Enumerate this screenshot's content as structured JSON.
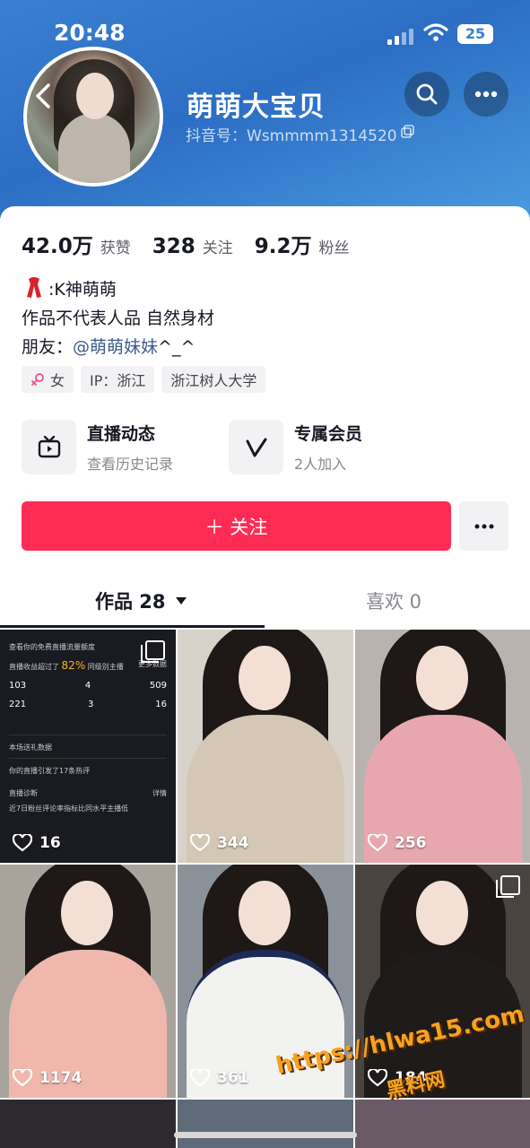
{
  "status": {
    "time": "20:48",
    "battery": "25"
  },
  "profile": {
    "name": "萌萌大宝贝",
    "douyin_id": "抖音号：Wsmmmm1314520",
    "stats": [
      {
        "value": "42.0万",
        "label": "获赞"
      },
      {
        "value": "328",
        "label": "关注"
      },
      {
        "value": "9.2万",
        "label": "粉丝"
      }
    ],
    "bio_line1": ":K神萌萌",
    "bio_line2": "作品不代表人品 自然身材",
    "bio_line3_prefix": "朋友：",
    "bio_line3_mention": "@萌萌妹妹",
    "bio_line3_suffix": "^_^",
    "tags": {
      "gender": "女",
      "ip": "IP：浙江",
      "school": "浙江树人大学"
    }
  },
  "entries": [
    {
      "title": "直播动态",
      "subtitle": "查看历史记录",
      "icon": "tv-icon"
    },
    {
      "title": "专属会员",
      "subtitle": "2人加入",
      "icon": "v-icon"
    }
  ],
  "actions": {
    "follow_label": "＋ 关注"
  },
  "tabs": {
    "works": "作品 28",
    "likes": "喜欢 0"
  },
  "dash": {
    "title": "查看你的免费直播流量额度",
    "line": "直播收益超过了",
    "pct": "82%",
    "line_tail": "同级别主播",
    "more": "更多数据",
    "nums": [
      "103",
      "4",
      "509",
      "221",
      "3",
      "16"
    ],
    "gift": "本场送礼数据",
    "hot": "你的直播引发了17条热评",
    "diag": "直播诊断",
    "detail": "详情",
    "note": "近7日粉丝评论率指标比同水平主播低"
  },
  "videos": [
    {
      "likes": "16"
    },
    {
      "likes": "344"
    },
    {
      "likes": "256"
    },
    {
      "likes": "1174"
    },
    {
      "likes": "361"
    },
    {
      "likes": "184"
    }
  ],
  "watermark": {
    "url": "https://hlwa15.com",
    "site": "黑料网"
  },
  "colors": {
    "accent": "#fe2c55",
    "header_blue": "#2c6ec4",
    "mention": "#3e5a8c"
  }
}
